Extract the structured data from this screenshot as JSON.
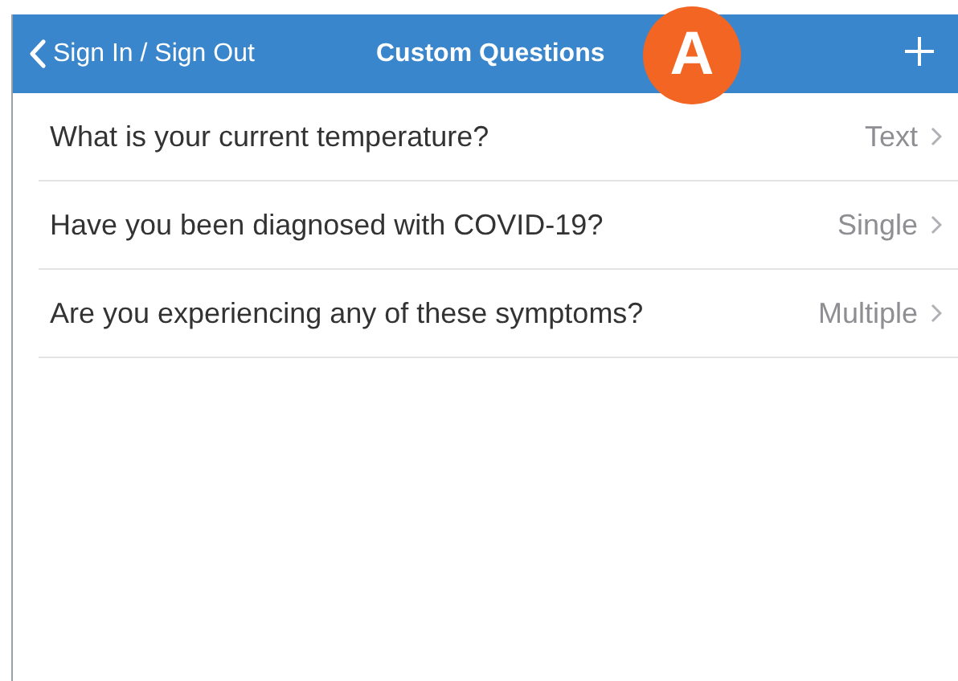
{
  "nav_bar": {
    "back": "Sign In / Sign Out",
    "title": "Custom Questions",
    "badge": "A"
  },
  "questions": [
    {
      "text": "What is your current temperature?",
      "type": "Text"
    },
    {
      "text": "Have you been diagnosed with COVID-19?",
      "type": "Single"
    },
    {
      "text": "Are you experiencing any of these symptoms?",
      "type": "Multiple"
    }
  ]
}
